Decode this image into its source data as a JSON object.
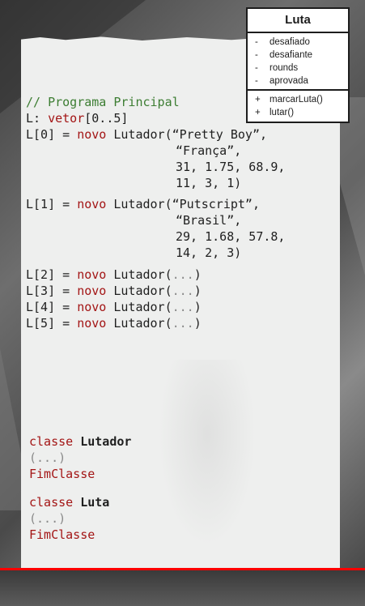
{
  "main_code": {
    "comment": "// Programa Principal",
    "l_decl": {
      "a": "L: ",
      "b": "vetor",
      "c": "[0..5]"
    },
    "l0": {
      "a": "L[0] = ",
      "b": "novo",
      "c": " Lutador(",
      "d": "“Pretty Boy”,",
      "e": "“França”,",
      "f": "31, 1.75, 68.9,",
      "g": "11, 3, 1)"
    },
    "l1": {
      "a": "L[1] = ",
      "b": "novo",
      "c": " Lutador(",
      "d": "“Putscript”,",
      "e": "“Brasil”,",
      "f": "29, 1.68, 57.8,",
      "g": "14, 2, 3)"
    },
    "rest": [
      {
        "a": "L[2] = ",
        "b": "novo",
        "c": " Lutador(",
        "d": "...",
        "e": ")"
      },
      {
        "a": "L[3] = ",
        "b": "novo",
        "c": " Lutador(",
        "d": "...",
        "e": ")"
      },
      {
        "a": "L[4] = ",
        "b": "novo",
        "c": " Lutador(",
        "d": "...",
        "e": ")"
      },
      {
        "a": "L[5] = ",
        "b": "novo",
        "c": " Lutador(",
        "d": "...",
        "e": ")"
      }
    ]
  },
  "classes": [
    {
      "kw": "classe ",
      "name": "Lutador",
      "body": "(...)",
      "end": "FimClasse"
    },
    {
      "kw": "classe ",
      "name": "Luta",
      "body": "(...)",
      "end": "FimClasse"
    }
  ],
  "uml": {
    "title": "Luta",
    "attributes": [
      {
        "mark": "-",
        "name": "desafiado"
      },
      {
        "mark": "-",
        "name": "desafiante"
      },
      {
        "mark": "-",
        "name": "rounds"
      },
      {
        "mark": "-",
        "name": "aprovada"
      }
    ],
    "methods": [
      {
        "mark": "+",
        "name": "marcarLuta()"
      },
      {
        "mark": "+",
        "name": "lutar()"
      }
    ]
  },
  "video": {
    "progress_fraction": 1.0,
    "progress_color": "#ff0000"
  },
  "colors": {
    "comment": "#3c7d32",
    "keyword": "#a31515",
    "ellipsis": "#8a8a8a"
  }
}
